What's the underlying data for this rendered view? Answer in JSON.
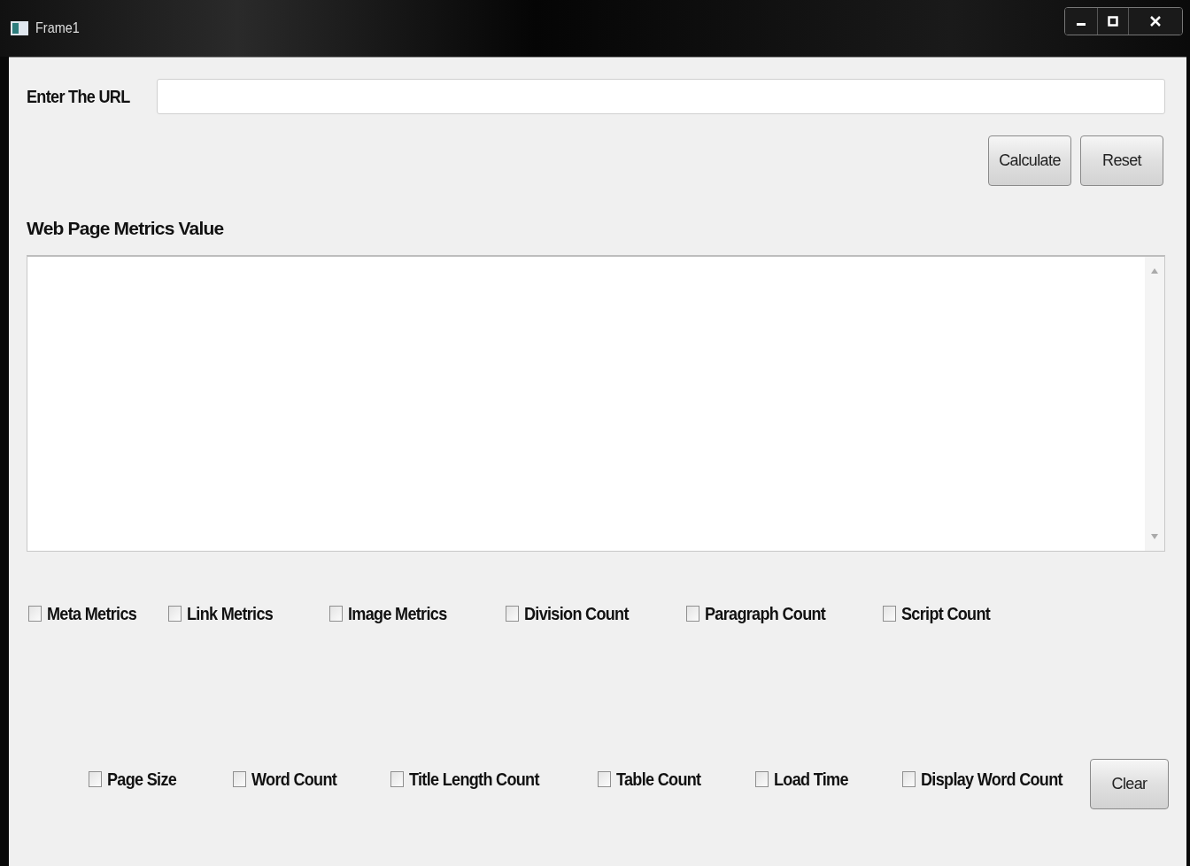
{
  "window": {
    "title": "Frame1"
  },
  "url_field": {
    "label": "Enter The URL"
  },
  "buttons": [
    {
      "label": "Calculate"
    },
    {
      "label": "Reset"
    }
  ],
  "output": {
    "label": "Web Page Metrics Value"
  },
  "checkbox_rows": [
    [
      {
        "label": "Meta Metrics",
        "checked": false
      },
      {
        "label": "Link Metrics",
        "checked": false
      },
      {
        "label": "Image Metrics",
        "checked": false
      },
      {
        "label": "Division Count",
        "checked": false
      },
      {
        "label": "Paragraph Count",
        "checked": false
      },
      {
        "label": "Script Count",
        "checked": false
      }
    ],
    [
      {
        "label": "Page Size",
        "checked": false
      },
      {
        "label": "Word Count",
        "checked": false
      },
      {
        "label": "Title Length Count",
        "checked": false
      },
      {
        "label": "Table Count",
        "checked": false
      },
      {
        "label": "Load Time",
        "checked": false
      },
      {
        "label": "Display Word Count",
        "checked": false
      }
    ]
  ],
  "clear_button": {
    "label": "Clear"
  }
}
